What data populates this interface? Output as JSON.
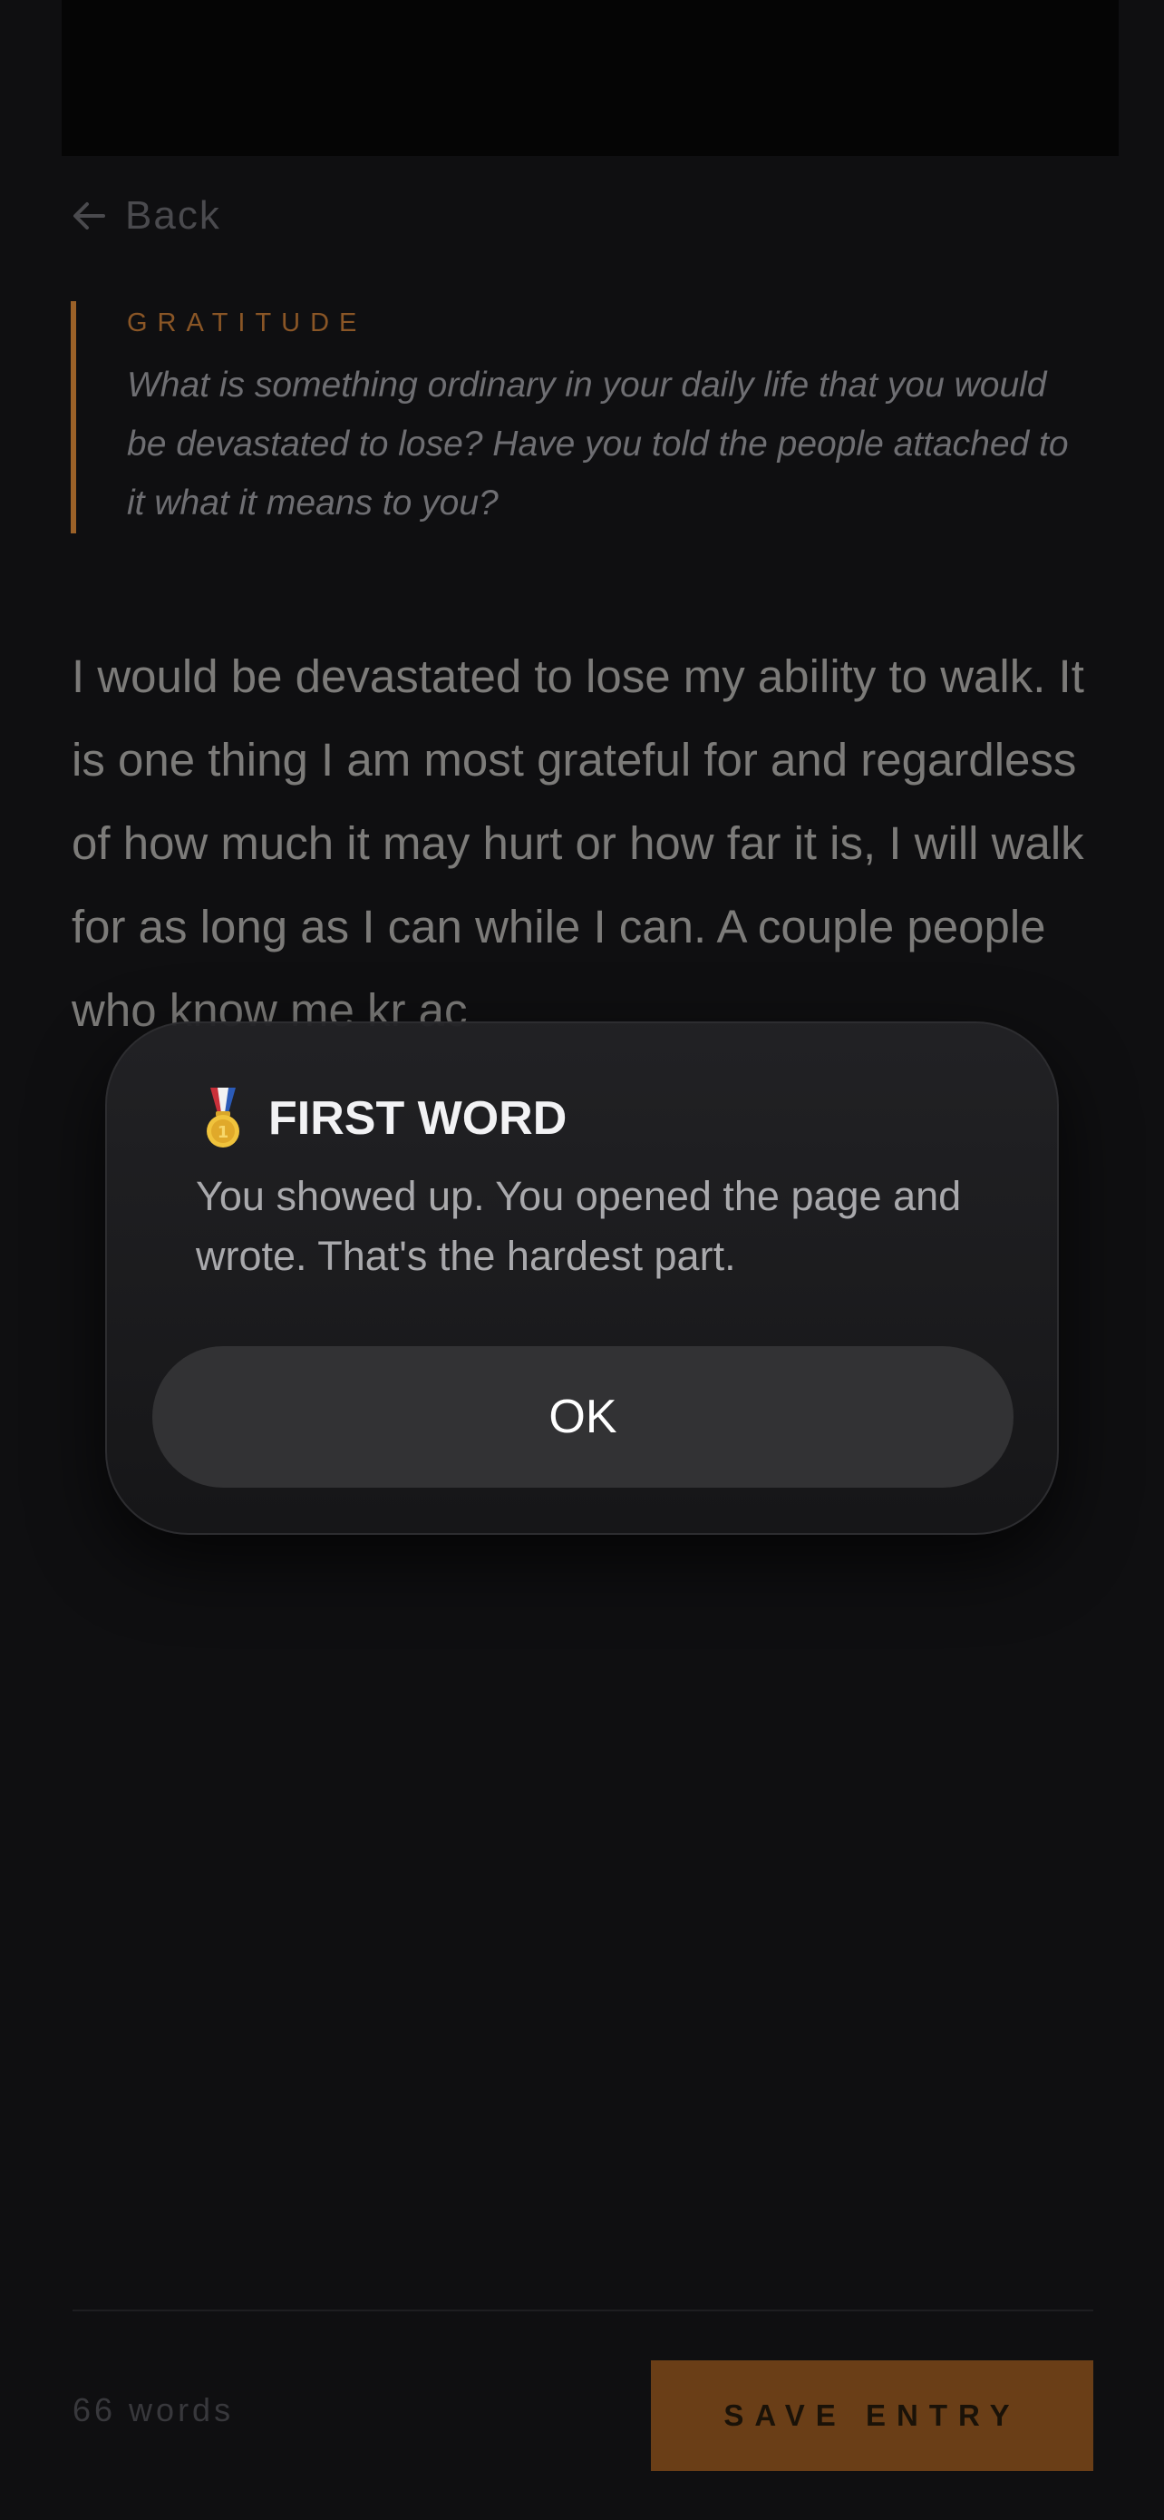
{
  "nav": {
    "back_label": "Back",
    "back_icon": "arrow-left-icon"
  },
  "prompt": {
    "category": "GRATITUDE",
    "text": "What is something ordinary in your daily life that you would be devastated to lose? Have you told the people attached to it what it means to you?",
    "accent_color": "#9b6128"
  },
  "entry": {
    "text": "I would be devastated to lose my ability to walk. It is one thing I am most grateful for and regardless of how much it may hurt or how far it is, I will walk for as long as I can while I can. A couple people who know me kr                                                         ac"
  },
  "footer": {
    "word_count": "66 words",
    "save_label": "SAVE ENTRY",
    "save_color": "#6a3e17"
  },
  "modal": {
    "icon": "medal-icon",
    "title": "FIRST WORD",
    "body": "You showed up. You opened the page and wrote. That's the hardest part.",
    "ok_label": "OK"
  }
}
